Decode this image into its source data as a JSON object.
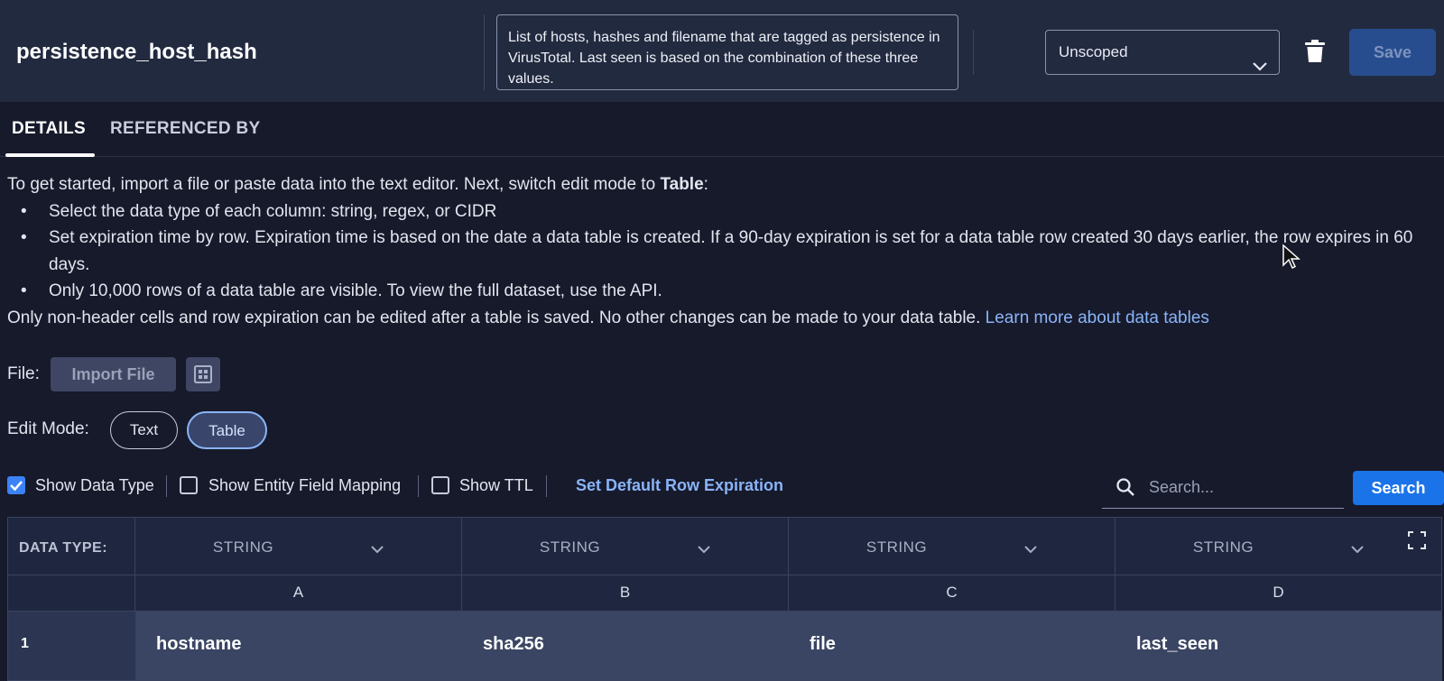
{
  "header": {
    "table_name": "persistence_host_hash",
    "description": "List of hosts, hashes and filename that are tagged as persistence in VirusTotal. Last seen is based on the combination of these three values.",
    "scope_selected": "Unscoped",
    "save_label": "Save"
  },
  "tabs": [
    {
      "label": "DETAILS",
      "active": true
    },
    {
      "label": "REFERENCED BY",
      "active": false
    }
  ],
  "instructions": {
    "intro_prefix": "To get started, import a file or paste data into the text editor. Next, switch edit mode to ",
    "intro_bold": "Table",
    "intro_suffix": ":",
    "bullets": [
      "Select the data type of each column: string, regex, or CIDR",
      "Set expiration time by row. Expiration time is based on the date a data table is created. If a 90-day expiration is set for a data table row created 30 days earlier, the row expires in 60 days.",
      "Only 10,000 rows of a data table are visible. To view the full dataset, use the API."
    ],
    "footer_text": "Only non-header cells and row expiration can be edited after a table is saved. No other changes can be made to your data table. ",
    "learn_more_link": "Learn more about data tables"
  },
  "file": {
    "label": "File:",
    "import_label": "Import File"
  },
  "edit_mode": {
    "label": "Edit Mode:",
    "options": [
      "Text",
      "Table"
    ],
    "selected": "Table"
  },
  "options": {
    "show_data_type": {
      "label": "Show Data Type",
      "checked": true
    },
    "show_entity_field_mapping": {
      "label": "Show Entity Field Mapping",
      "checked": false
    },
    "show_ttl": {
      "label": "Show TTL",
      "checked": false
    },
    "set_default_expiration_label": "Set Default Row Expiration"
  },
  "search": {
    "placeholder": "Search...",
    "button_label": "Search"
  },
  "grid": {
    "data_type_label": "DATA TYPE:",
    "columns": [
      {
        "letter": "A",
        "type": "STRING"
      },
      {
        "letter": "B",
        "type": "STRING"
      },
      {
        "letter": "C",
        "type": "STRING"
      },
      {
        "letter": "D",
        "type": "STRING"
      }
    ],
    "rows": [
      {
        "num": "1",
        "cells": [
          "hostname",
          "sha256",
          "file",
          "last_seen"
        ]
      }
    ]
  },
  "colors": {
    "accent": "#1a73e8",
    "link": "#8ab4f8",
    "background": "#171a2b",
    "header_bg": "#222a40"
  }
}
